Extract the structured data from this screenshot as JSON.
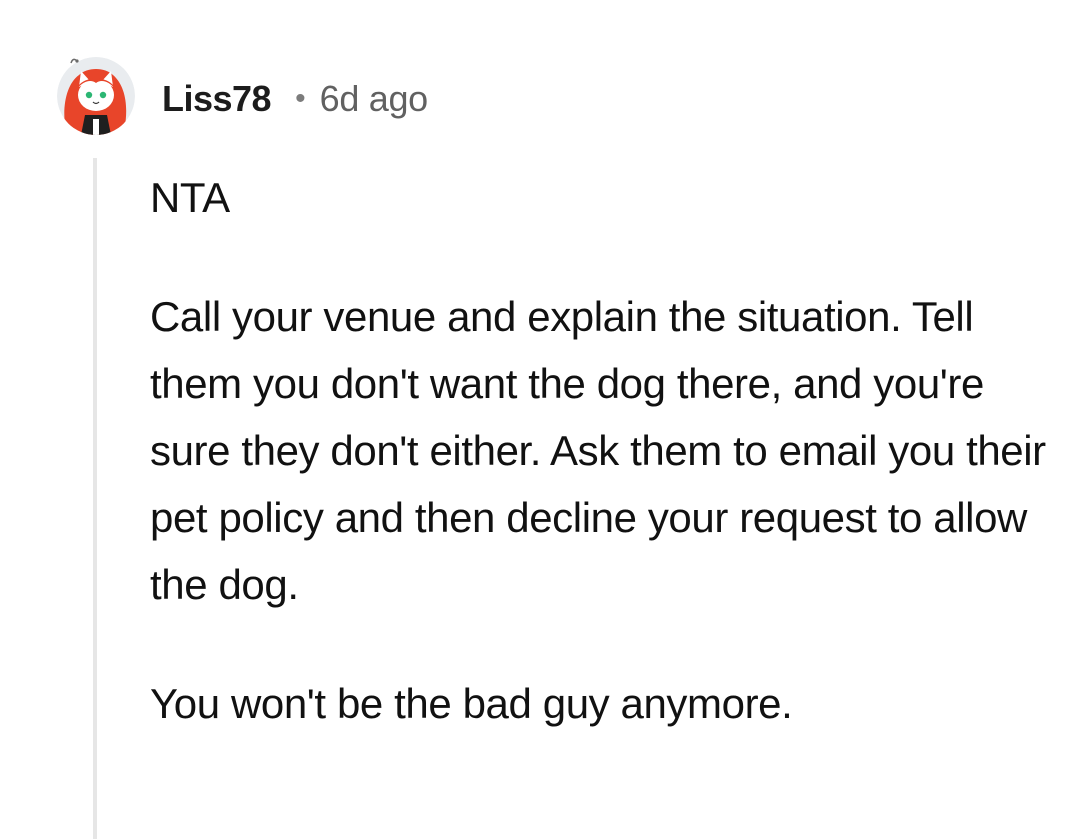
{
  "comment": {
    "author": "Liss78",
    "separator": "•",
    "age": "6d ago",
    "avatar_icon": "cat-avatar-icon",
    "paragraphs": [
      "NTA",
      "Call your venue and explain the situation. Tell them you don't want the dog there, and you're sure they don't either. Ask them to email you their pet policy and then decline your request to allow the dog.",
      "You won't be the bad guy anymore."
    ]
  },
  "colors": {
    "background": "#ffffff",
    "text": "#111111",
    "meta": "#616161",
    "thread_line": "#e6e6e6",
    "avatar_hair": "#e8452a"
  }
}
